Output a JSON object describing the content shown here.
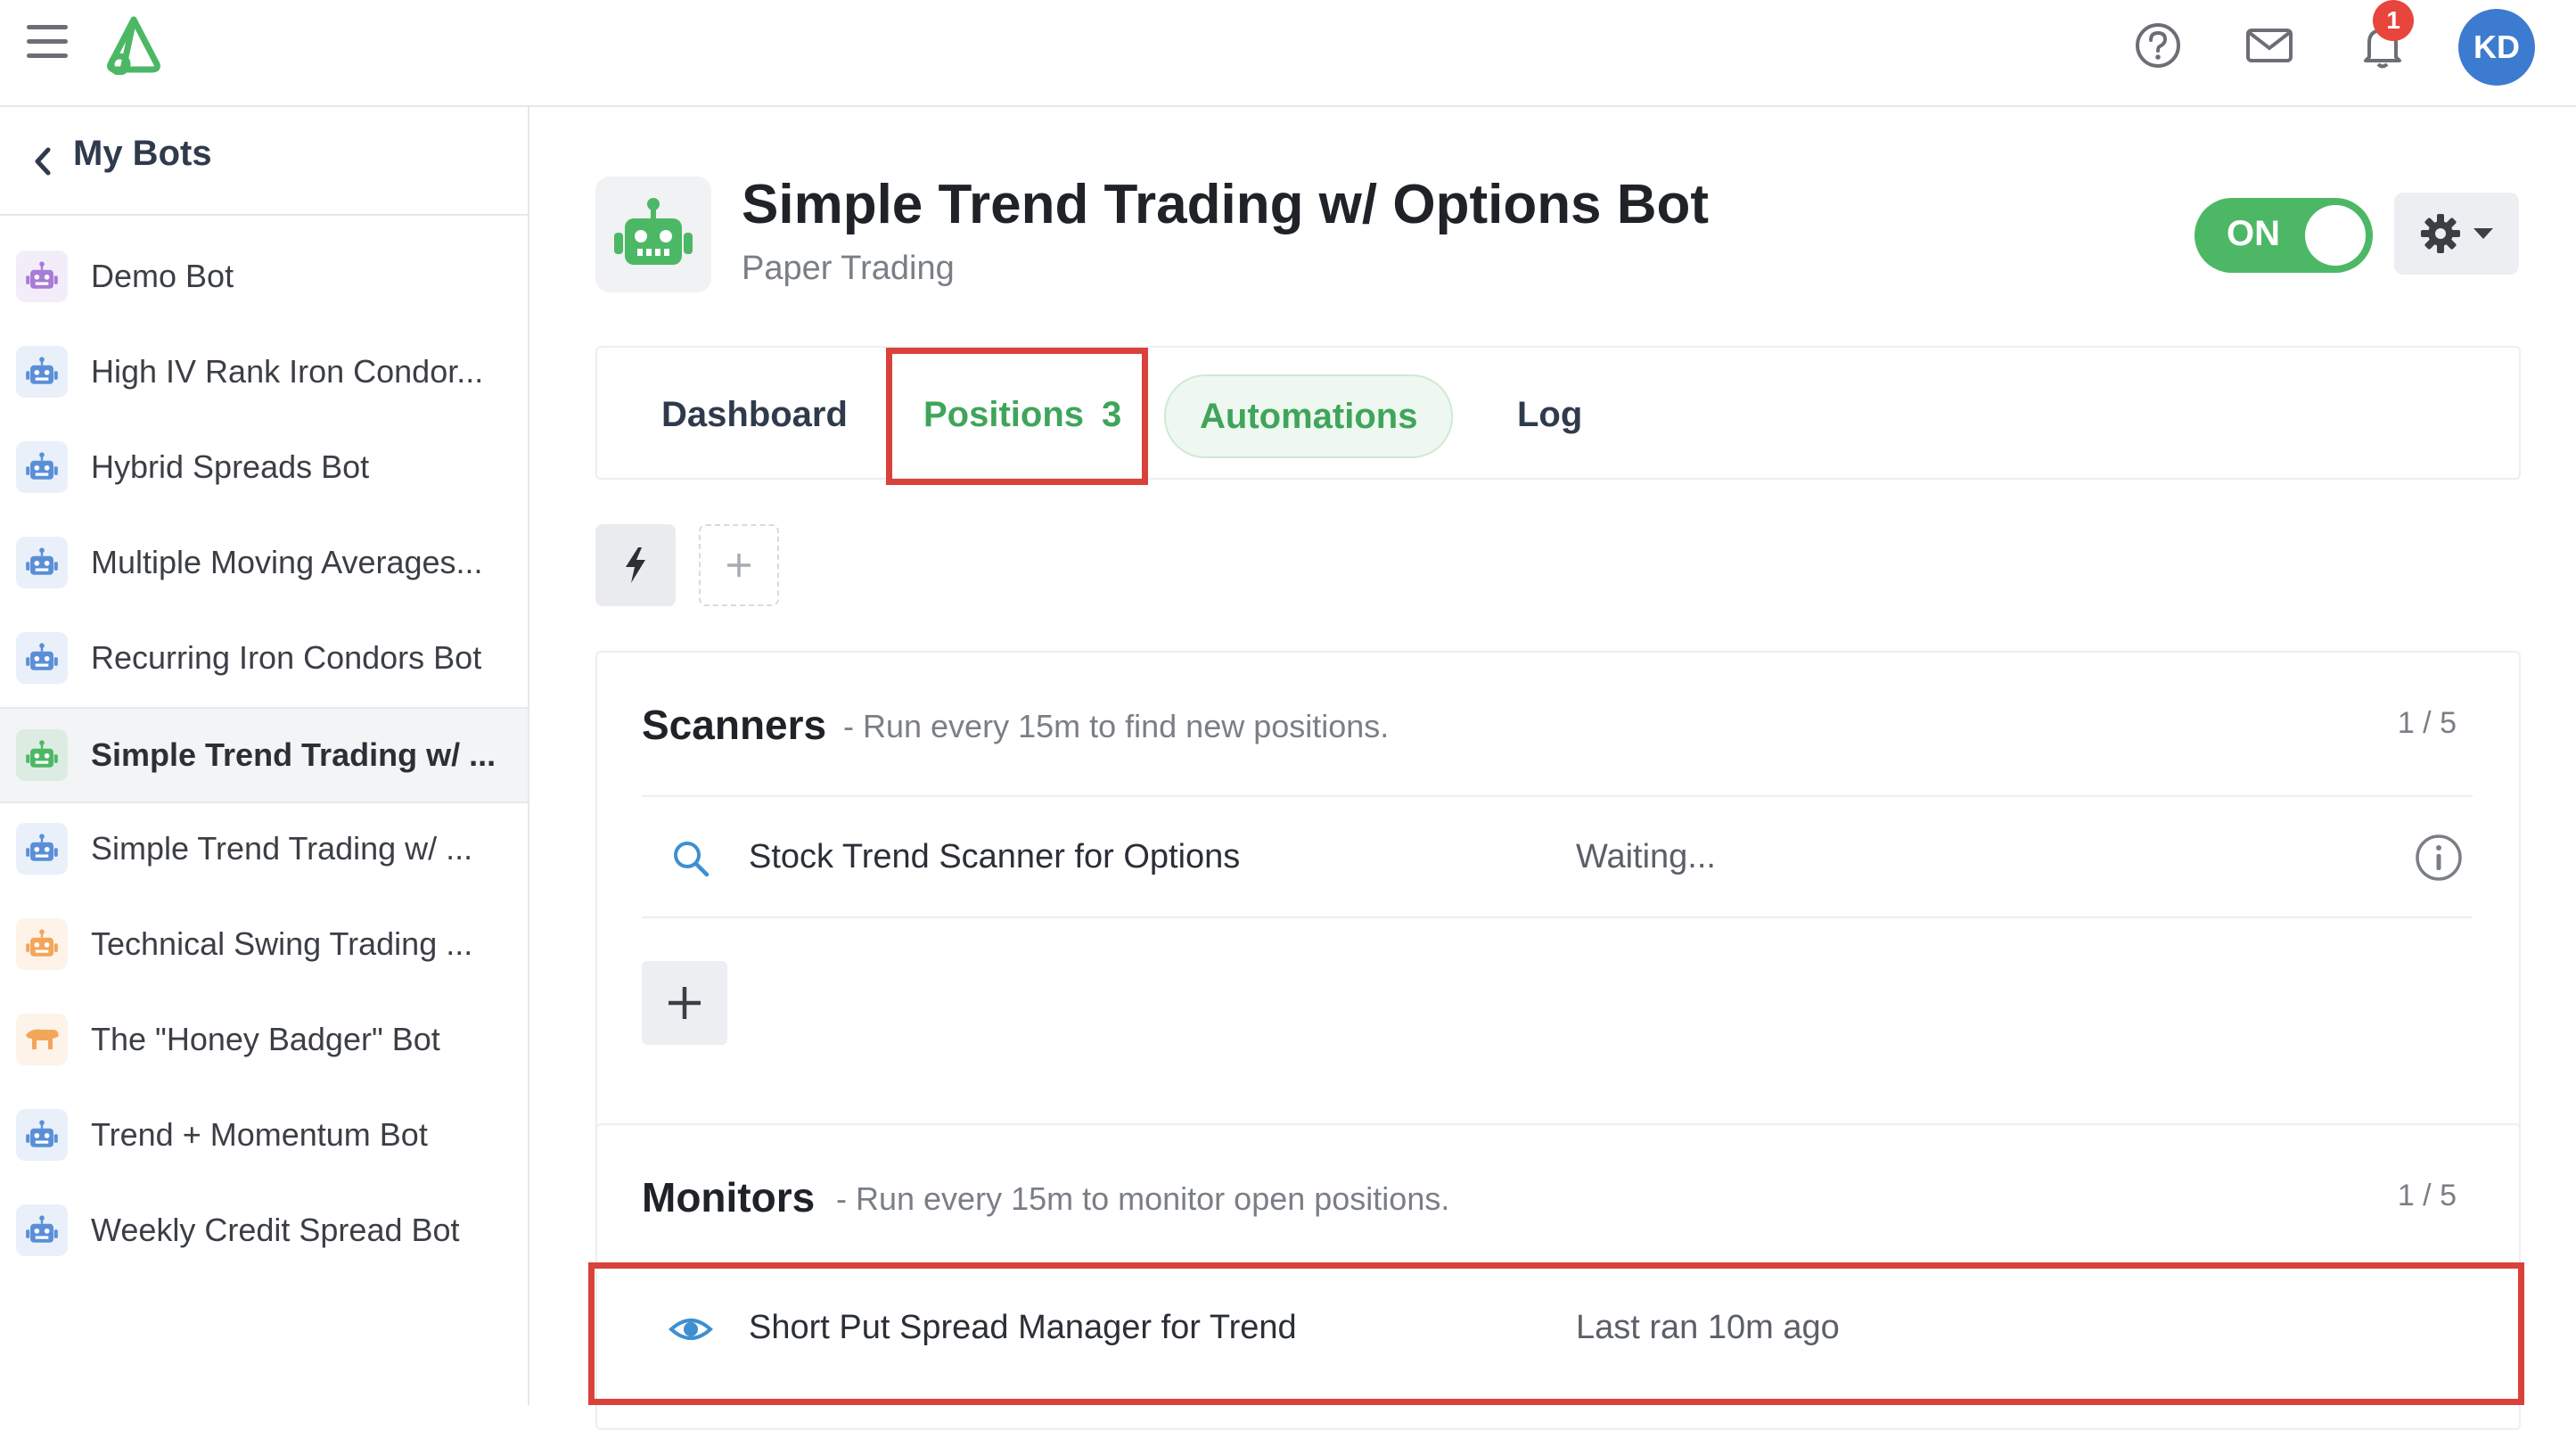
{
  "topbar": {
    "icons": [
      "menu-icon",
      "logo-icon",
      "help-icon",
      "mail-icon",
      "bell-icon"
    ],
    "notification_count": "1",
    "avatar_initials": "KD"
  },
  "sidebar": {
    "title": "My Bots",
    "items": [
      {
        "label": "Demo Bot",
        "color": "#a77bd6",
        "icon": "robot-icon",
        "active": false
      },
      {
        "label": "High IV Rank Iron Condor...",
        "color": "#5a8fd8",
        "icon": "robot-icon",
        "active": false
      },
      {
        "label": "Hybrid Spreads Bot",
        "color": "#5a8fd8",
        "icon": "robot-icon",
        "active": false
      },
      {
        "label": "Multiple Moving Averages...",
        "color": "#5a8fd8",
        "icon": "robot-icon",
        "active": false
      },
      {
        "label": "Recurring Iron Condors Bot",
        "color": "#5a8fd8",
        "icon": "robot-icon",
        "active": false
      },
      {
        "label": "Simple Trend Trading w/ ...",
        "color": "#4cb865",
        "icon": "robot-icon",
        "active": true
      },
      {
        "label": "Simple Trend Trading w/ ...",
        "color": "#5a8fd8",
        "icon": "robot-icon",
        "active": false
      },
      {
        "label": "Technical Swing Trading ...",
        "color": "#f2a65a",
        "icon": "robot-icon",
        "active": false
      },
      {
        "label": "The \"Honey Badger\" Bot",
        "color": "#f2a65a",
        "icon": "badger-icon",
        "active": false
      },
      {
        "label": "Trend + Momentum Bot",
        "color": "#5a8fd8",
        "icon": "robot-icon",
        "active": false
      },
      {
        "label": "Weekly Credit Spread Bot",
        "color": "#5a8fd8",
        "icon": "robot-icon",
        "active": false
      }
    ]
  },
  "header": {
    "title": "Simple Trend Trading w/ Options Bot",
    "subtitle": "Paper Trading",
    "toggle_label": "ON",
    "accent_color": "#4cb865"
  },
  "tabs": {
    "dashboard": "Dashboard",
    "positions": "Positions",
    "positions_count": "3",
    "automations": "Automations",
    "log": "Log"
  },
  "scanners": {
    "title": "Scanners",
    "description": "- Run every 15m to find new positions.",
    "count": "1 / 5",
    "rows": [
      {
        "name": "Stock Trend Scanner for Options",
        "status": "Waiting..."
      }
    ]
  },
  "monitors": {
    "title": "Monitors",
    "description": "- Run every 15m to monitor open positions.",
    "count": "1 / 5",
    "rows": [
      {
        "name": "Short Put Spread Manager for Trend",
        "status": "Last ran 10m ago"
      }
    ]
  }
}
